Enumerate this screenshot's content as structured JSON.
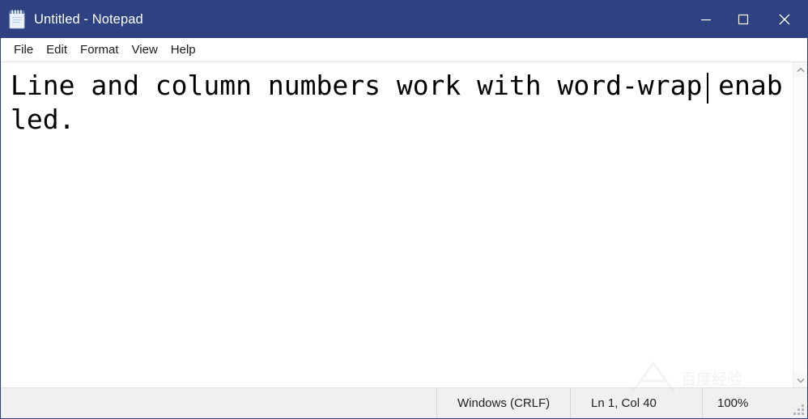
{
  "window": {
    "title": "Untitled - Notepad",
    "app_icon": "notepad-icon",
    "titlebar_color": "#2e4180",
    "titlebar_text_color": "#ffffff",
    "background_color": "#ffffff"
  },
  "controls": {
    "minimize_label": "─",
    "maximize_label": "☐",
    "close_label": "✕",
    "minimize_name": "minimize-icon",
    "maximize_name": "maximize-icon",
    "close_name": "close-icon"
  },
  "menubar": {
    "items": [
      {
        "label": "File"
      },
      {
        "label": "Edit"
      },
      {
        "label": "Format"
      },
      {
        "label": "View"
      },
      {
        "label": "Help"
      }
    ]
  },
  "editor": {
    "content": "Line and column numbers work with word-wrap enabled.",
    "caret_visible": true,
    "word_wrap": true,
    "font": "monospace",
    "text_color": "#000000"
  },
  "scrollbar": {
    "up_arrow": "⌃",
    "down_arrow": "⌄",
    "orientation": "vertical",
    "thumb_visible": false
  },
  "statusbar": {
    "encoding_eol": "Windows (CRLF)",
    "line_column": "Ln 1, Col 40",
    "zoom": "100%",
    "background_color": "#f0f0f0"
  },
  "watermark": {
    "text": "百度经验"
  }
}
